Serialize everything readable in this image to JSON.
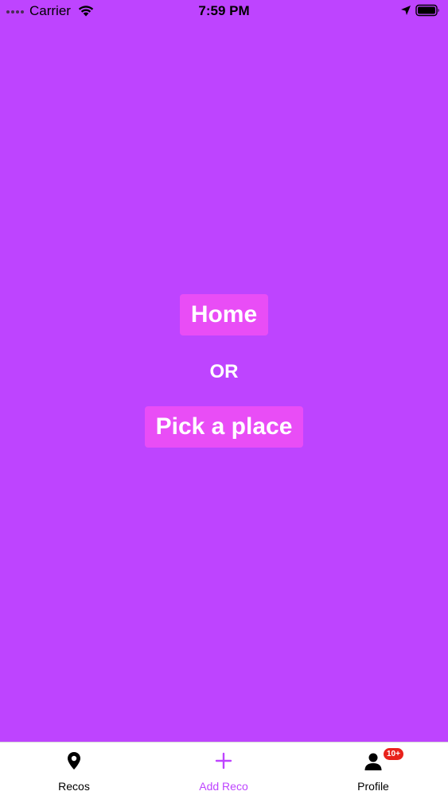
{
  "status_bar": {
    "carrier": "Carrier",
    "time": "7:59 PM"
  },
  "main": {
    "home_button": "Home",
    "or_label": "OR",
    "pick_place_button": "Pick a place"
  },
  "tab_bar": {
    "tabs": [
      {
        "label": "Recos",
        "icon": "map-pin-icon"
      },
      {
        "label": "Add Reco",
        "icon": "plus-icon"
      },
      {
        "label": "Profile",
        "icon": "person-icon",
        "badge": "10+"
      }
    ]
  },
  "colors": {
    "background": "#BE44FF",
    "button": "#E94DF6",
    "accent": "#BE44FF",
    "badge": "#E8221B"
  }
}
